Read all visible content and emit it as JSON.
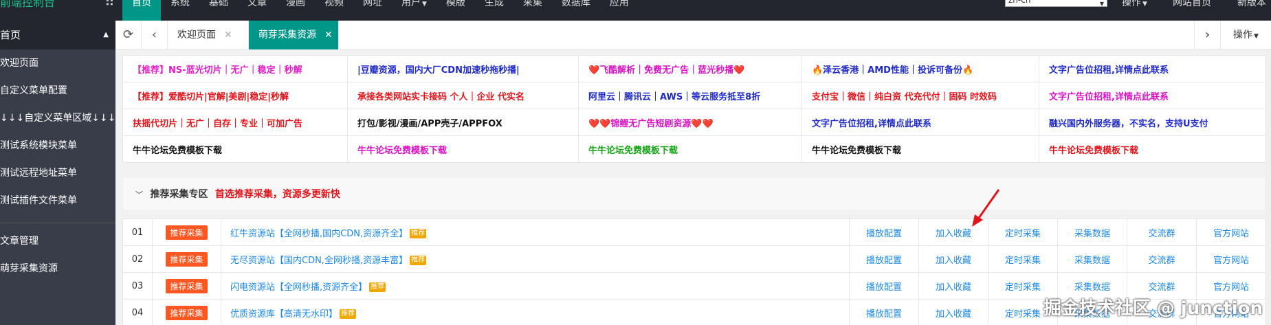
{
  "header": {
    "brand": "前端控制台",
    "nav": [
      "首页",
      "系统",
      "基础",
      "文章",
      "漫画",
      "视频",
      "网址",
      "用户",
      "模版",
      "生成",
      "采集",
      "数据库",
      "应用"
    ],
    "language": "zh-cn",
    "actions": "操作",
    "site_home": "网站首页",
    "new_version": "新版本"
  },
  "sidebar": {
    "head": "首页",
    "items": [
      "欢迎页面",
      "自定义菜单配置",
      "↓↓↓自定义菜单区域↓↓↓",
      "测试系统模块菜单",
      "测试远程地址菜单",
      "测试插件文件菜单"
    ],
    "group2": [
      "文章管理",
      "萌芽采集资源"
    ]
  },
  "tabs": {
    "items": [
      {
        "label": "欢迎页面"
      },
      {
        "label": "萌芽采集资源"
      }
    ],
    "actions": "操作"
  },
  "ads": [
    [
      {
        "text": "【推荐】NS-蓝光切片｜无广｜稳定｜秒解",
        "color": "pink"
      },
      {
        "text": "|豆瓣资源，国内大厂CDN加速秒拖秒播|",
        "color": "blue"
      },
      {
        "text": "❤️飞酷解析｜免费无广告｜蓝光秒播❤️",
        "color": "magenta"
      },
      {
        "text": "🔥泽云香港｜AMD性能｜投诉可备份🔥",
        "color": "blue"
      },
      {
        "text": "文字广告位招租,详情点此联系",
        "color": "blue"
      }
    ],
    [
      {
        "text": "【推荐】爱酷切片|官解|美剧|稳定|秒解",
        "color": "red"
      },
      {
        "text": "承接各类网站实卡接码 个人｜企业 代实名",
        "color": "red"
      },
      {
        "text": "阿里云｜腾讯云｜AWS｜等云服务抵至8折",
        "color": "blue"
      },
      {
        "text": "支付宝｜微信｜纯白资 代充代付｜固码 时效码",
        "color": "red"
      },
      {
        "text": "文字广告位招租,详情点此联系",
        "color": "magenta"
      }
    ],
    [
      {
        "text": "扶摇代切片｜无广｜自存｜专业｜可加广告",
        "color": "red"
      },
      {
        "text": "打包/影视/漫画/APP壳子/APPFOX",
        "color": "black"
      },
      {
        "text": "❤️❤️锦鲤无广告短剧资源❤️❤️",
        "color": "magenta"
      },
      {
        "text": "文字广告位招租,详情点此联系",
        "color": "blue"
      },
      {
        "text": "融兴国内外服务器，不实名，支持U支付",
        "color": "blue"
      }
    ],
    [
      {
        "text": "牛牛论坛免费模板下载",
        "color": "black"
      },
      {
        "text": "牛牛论坛免费模板下载",
        "color": "magenta"
      },
      {
        "text": "牛牛论坛免费模板下载",
        "color": "green"
      },
      {
        "text": "牛牛论坛免费模板下载",
        "color": "black"
      },
      {
        "text": "牛牛论坛免费模板下载",
        "color": "red"
      }
    ]
  ],
  "section": {
    "title": "推荐采集专区",
    "subtitle": "首选推荐采集，资源多更新快"
  },
  "resources": [
    {
      "num": "01",
      "tag": "推荐采集",
      "name": "红牛资源站【全网秒播,国内CDN,资源齐全】",
      "hot": "推荐"
    },
    {
      "num": "02",
      "tag": "推荐采集",
      "name": "无尽资源站【国内CDN,全网秒播,资源丰富】",
      "hot": "推荐"
    },
    {
      "num": "03",
      "tag": "推荐采集",
      "name": "闪电资源站【全网秒播,资源齐全】",
      "hot": "推荐"
    },
    {
      "num": "04",
      "tag": "推荐采集",
      "name": "优质资源库【高清无水印】",
      "hot": "推荐"
    }
  ],
  "res_actions": [
    "播放配置",
    "加入收藏",
    "定时采集",
    "采集数据",
    "交流群",
    "官方网站"
  ],
  "watermark": "掘金技术社区 @ junction"
}
